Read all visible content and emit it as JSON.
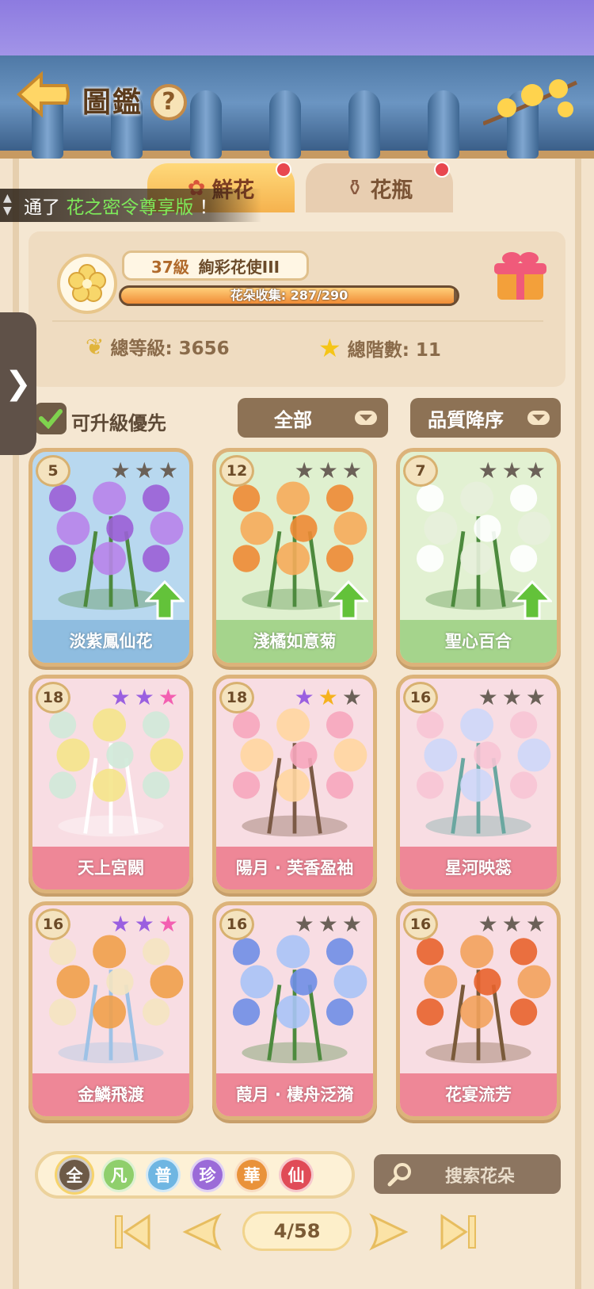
{
  "header": {
    "title": "圖鑑",
    "help_label": "?"
  },
  "tabs": [
    {
      "label": "鮮花",
      "active": true
    },
    {
      "label": "花瓶",
      "active": false
    }
  ],
  "ticker": {
    "prefix": "通了",
    "highlight": "花之密令尊享版",
    "suffix": "！"
  },
  "profile": {
    "level": "37級",
    "rank_title": "絢彩花使III",
    "collection_text": "花朵收集: 287/290",
    "collection_fraction": 0.9897,
    "total_level": "總等級: 3656",
    "total_stars": "總階數: 11"
  },
  "filters": {
    "upgrade_first_label": "可升級優先",
    "upgrade_first_checked": true,
    "category": "全部",
    "sort": "品質降序"
  },
  "cards": [
    {
      "name": "淡紫鳳仙花",
      "level": "5",
      "stars": [
        "gray",
        "gray",
        "gray"
      ],
      "bg": "#b8d8ef",
      "band": "#8fbde0",
      "upgrade": true,
      "icon": "purple-flower-art"
    },
    {
      "name": "淺橘如意菊",
      "level": "12",
      "stars": [
        "gray",
        "gray",
        "gray"
      ],
      "bg": "#dff0cf",
      "band": "#a5d48c",
      "upgrade": true,
      "icon": "orange-chrysanthemum-art"
    },
    {
      "name": "聖心百合",
      "level": "7",
      "stars": [
        "gray",
        "gray",
        "gray"
      ],
      "bg": "#e2f1d2",
      "band": "#a5d48c",
      "upgrade": true,
      "icon": "white-lily-art"
    },
    {
      "name": "天上宮闕",
      "level": "18",
      "stars": [
        "purple",
        "purple",
        "rainbow"
      ],
      "bg": "#f8dde3",
      "band": "#ee8797",
      "upgrade": false,
      "icon": "heavenly-palace-art"
    },
    {
      "name": "陽月 · 芙香盈袖",
      "level": "18",
      "stars": [
        "purple",
        "gold",
        "gray"
      ],
      "bg": "#f8dde3",
      "band": "#ee8797",
      "upgrade": false,
      "icon": "lady-portrait-art"
    },
    {
      "name": "星河映蕊",
      "level": "16",
      "stars": [
        "gray",
        "gray",
        "gray"
      ],
      "bg": "#f8dde3",
      "band": "#ee8797",
      "upgrade": false,
      "icon": "white-roses-art"
    },
    {
      "name": "金鱗飛渡",
      "level": "16",
      "stars": [
        "purple",
        "purple",
        "rainbow"
      ],
      "bg": "#f8dde3",
      "band": "#ee8797",
      "upgrade": false,
      "icon": "golden-koi-art"
    },
    {
      "name": "葭月 · 棲舟泛漪",
      "level": "16",
      "stars": [
        "gray",
        "gray",
        "gray"
      ],
      "bg": "#f8dde3",
      "band": "#ee8797",
      "upgrade": false,
      "icon": "boat-lady-art"
    },
    {
      "name": "花宴流芳",
      "level": "16",
      "stars": [
        "gray",
        "gray",
        "gray"
      ],
      "bg": "#f8dde3",
      "band": "#ee8797",
      "upgrade": false,
      "icon": "flower-banquet-art"
    }
  ],
  "rarity_filters": [
    {
      "label": "全",
      "color": "#6d5a47",
      "selected": true
    },
    {
      "label": "凡",
      "color": "#8fcf6c",
      "selected": false
    },
    {
      "label": "普",
      "color": "#6fb6e2",
      "selected": false
    },
    {
      "label": "珍",
      "color": "#9b6bd8",
      "selected": false
    },
    {
      "label": "華",
      "color": "#e9923a",
      "selected": false
    },
    {
      "label": "仙",
      "color": "#e04b57",
      "selected": false
    }
  ],
  "search": {
    "placeholder": "搜索花朵"
  },
  "pager": {
    "text": "4/58"
  },
  "colors": {
    "accent": "#f5b24e",
    "text": "#6b5237"
  }
}
